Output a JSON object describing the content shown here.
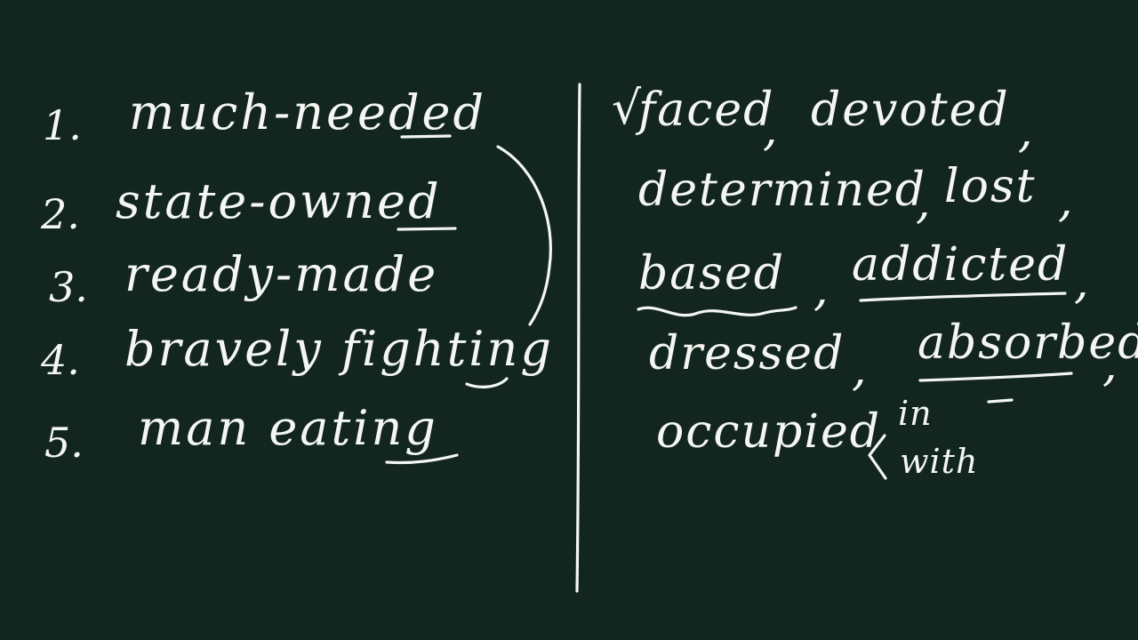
{
  "left_list": [
    {
      "number": "1.",
      "phrase": "much-needed"
    },
    {
      "number": "2.",
      "phrase": "state-owned"
    },
    {
      "number": "3.",
      "phrase": "ready-made"
    },
    {
      "number": "4.",
      "phrase": "bravely fighting"
    },
    {
      "number": "5.",
      "phrase": "man eating"
    }
  ],
  "right_words": {
    "faced": "faced",
    "comma_1": ",",
    "devoted": "devoted",
    "comma_2": ",",
    "determined": "determined",
    "comma_3": ",",
    "lost": "lost",
    "comma_4": ",",
    "based": "based",
    "comma_5": ",",
    "addicted": "addicted",
    "comma_6": ",",
    "dressed": "dressed",
    "comma_7": ",",
    "absorbed": "absorbed",
    "comma_8": ",",
    "occupied": "occupied",
    "in": "in",
    "with": "with"
  },
  "colors": {
    "board": "#12261f",
    "chalk": "#f4f6f2"
  }
}
